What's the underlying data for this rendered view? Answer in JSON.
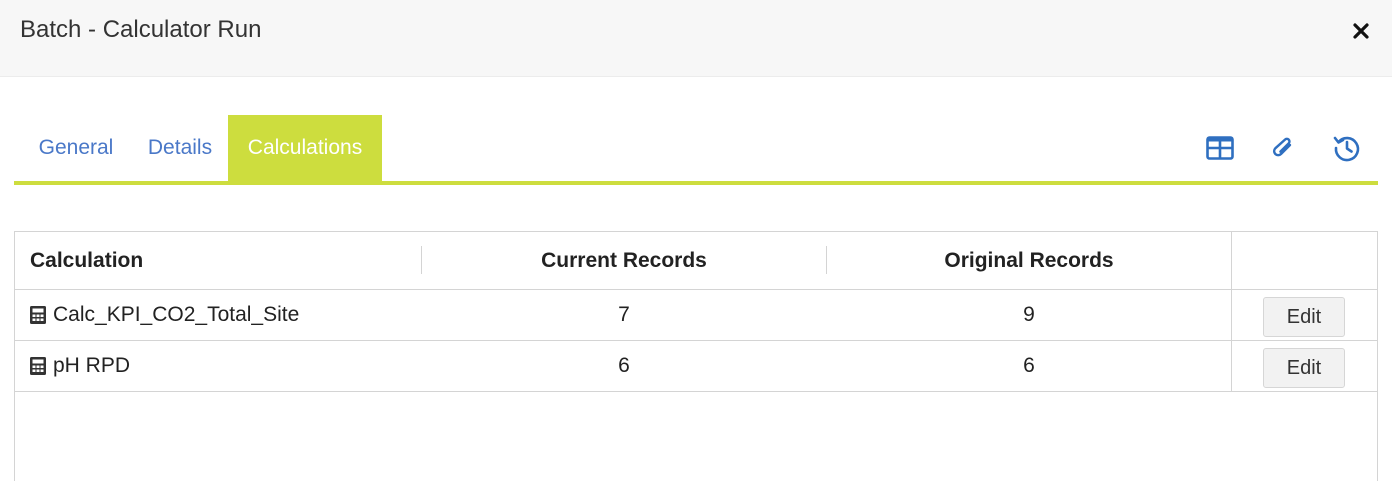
{
  "header": {
    "title": "Batch - Calculator Run",
    "close_icon": "close-icon"
  },
  "tabs": [
    {
      "label": "General",
      "active": false
    },
    {
      "label": "Details",
      "active": false
    },
    {
      "label": "Calculations",
      "active": true
    }
  ],
  "toolbar": {
    "icons": [
      "table-icon",
      "paperclip-icon",
      "history-icon"
    ]
  },
  "colors": {
    "accent": "#cddd3e",
    "link": "#4a78c8",
    "icon": "#2f6fc0"
  },
  "grid": {
    "columns": [
      "Calculation",
      "Current Records",
      "Original Records",
      ""
    ],
    "rows": [
      {
        "calculation": "Calc_KPI_CO2_Total_Site",
        "current": "7",
        "original": "9",
        "action": "Edit"
      },
      {
        "calculation": "pH RPD",
        "current": "6",
        "original": "6",
        "action": "Edit"
      }
    ]
  }
}
